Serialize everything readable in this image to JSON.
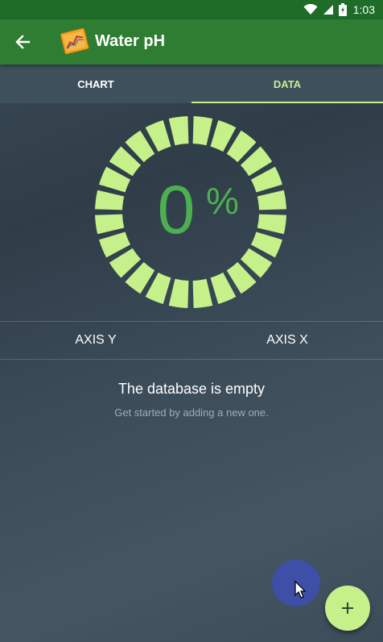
{
  "status_bar": {
    "time": "1:03",
    "icons": [
      "wifi-icon",
      "signal-icon",
      "battery-icon"
    ]
  },
  "app_bar": {
    "title": "Water pH",
    "back_icon": "arrow-back-icon",
    "logo_icon": "chart-notebook-icon"
  },
  "tabs": [
    {
      "label": "CHART",
      "selected": false
    },
    {
      "label": "DATA",
      "selected": true
    }
  ],
  "gauge": {
    "value": "0",
    "unit": "%",
    "fraction": 0,
    "segments": 24,
    "segment_color": "#c5f08a",
    "value_color": "#4caf50"
  },
  "table": {
    "columns": [
      "AXIS Y",
      "AXIS X"
    ]
  },
  "empty_state": {
    "title": "The database is empty",
    "subtitle": "Get started by adding a new one."
  },
  "fab": {
    "icon": "plus-icon",
    "color": "#c5f08a"
  },
  "colors": {
    "app_bar": "#2e7d32",
    "status_bar": "#1f6b28",
    "accent": "#c5f08a"
  }
}
